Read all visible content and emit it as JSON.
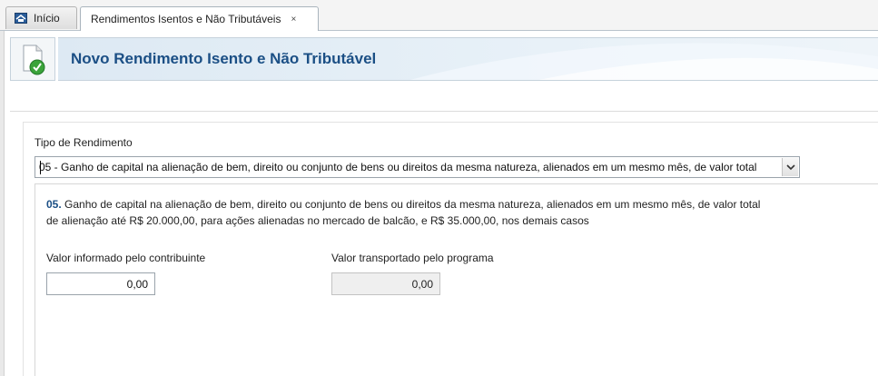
{
  "tabs": [
    {
      "label": "Início",
      "icon": "home-icon"
    },
    {
      "label": "Rendimentos Isentos e Não Tributáveis",
      "close": "×"
    }
  ],
  "header": {
    "title": "Novo Rendimento Isento e Não Tributável",
    "icon": "document-check-icon"
  },
  "form": {
    "tipo_label": "Tipo de Rendimento",
    "tipo_selected": "05 - Ganho de capital na alienação de bem, direito ou conjunto de bens ou direitos da mesma natureza, alienados em um mesmo mês, de valor total",
    "description": {
      "number": "05.",
      "text": " Ganho de capital na alienação de bem, direito ou conjunto de bens ou direitos da mesma natureza, alienados em um mesmo mês, de valor total de alienação até R$ 20.000,00, para ações alienadas no mercado de balcão, e R$ 35.000,00, nos demais casos"
    },
    "valor_informado": {
      "label": "Valor informado pelo contribuinte",
      "value": "0,00"
    },
    "valor_transportado": {
      "label": "Valor transportado pelo programa",
      "value": "0,00"
    }
  },
  "colors": {
    "accent": "#1b4f85",
    "header_bg": "#e3edf6",
    "check_green": "#2f9a2f"
  }
}
